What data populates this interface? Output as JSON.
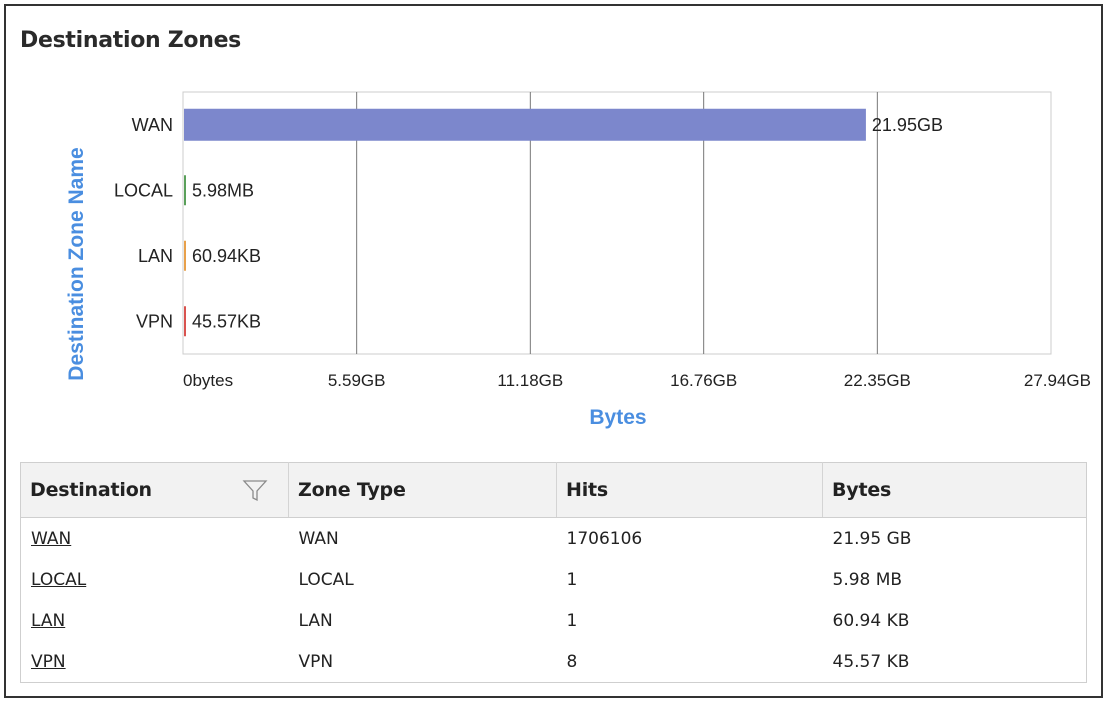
{
  "panel": {
    "title": "Destination Zones"
  },
  "colors": {
    "bar_wan": "#7c87cc",
    "bar_local": "#5aa05a",
    "bar_lan": "#e8a04a",
    "bar_vpn": "#d9534f",
    "axis_title": "#4a8ee0",
    "gridline": "#777777"
  },
  "chart_data": {
    "type": "bar",
    "orientation": "horizontal",
    "categories": [
      "WAN",
      "LOCAL",
      "LAN",
      "VPN"
    ],
    "values_gb": [
      21.95,
      0.00598,
      6.09e-05,
      4.56e-05
    ],
    "data_labels": [
      "21.95GB",
      "5.98MB",
      "60.94KB",
      "45.57KB"
    ],
    "xlabel": "Bytes",
    "ylabel": "Destination Zone Name",
    "xlim": [
      0,
      27.94
    ],
    "x_ticks": [
      0,
      5.59,
      11.18,
      16.76,
      22.35,
      27.94
    ],
    "x_tick_labels": [
      "0bytes",
      "5.59GB",
      "11.18GB",
      "16.76GB",
      "22.35GB",
      "27.94GB"
    ],
    "grid": true,
    "legend": "none"
  },
  "table": {
    "columns": [
      "Destination",
      "Zone Type",
      "Hits",
      "Bytes"
    ],
    "filter_icon": "funnel-icon",
    "rows": [
      {
        "destination": "WAN",
        "zone_type": "WAN",
        "hits": "1706106",
        "bytes": "21.95 GB"
      },
      {
        "destination": "LOCAL",
        "zone_type": "LOCAL",
        "hits": "1",
        "bytes": "5.98 MB"
      },
      {
        "destination": "LAN",
        "zone_type": "LAN",
        "hits": "1",
        "bytes": "60.94 KB"
      },
      {
        "destination": "VPN",
        "zone_type": "VPN",
        "hits": "8",
        "bytes": "45.57 KB"
      }
    ]
  }
}
